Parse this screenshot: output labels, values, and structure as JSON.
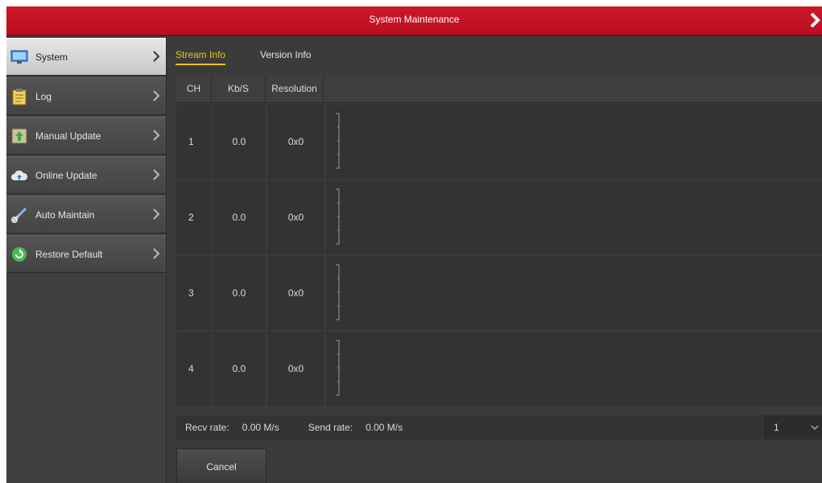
{
  "window": {
    "title": "System Maintenance"
  },
  "sidebar": {
    "items": [
      {
        "label": "System",
        "icon": "system-icon",
        "active": true
      },
      {
        "label": "Log",
        "icon": "log-icon"
      },
      {
        "label": "Manual Update",
        "icon": "manual-update-icon"
      },
      {
        "label": "Online Update",
        "icon": "cloud-icon"
      },
      {
        "label": "Auto Maintain",
        "icon": "tools-icon"
      },
      {
        "label": "Restore Default",
        "icon": "restore-icon"
      }
    ]
  },
  "tabs": [
    {
      "label": "Stream Info",
      "active": true
    },
    {
      "label": "Version Info"
    }
  ],
  "table": {
    "headers": [
      "CH",
      "Kb/S",
      "Resolution"
    ],
    "rows": [
      {
        "ch": "1",
        "kbs": "0.0",
        "resolution": "0x0"
      },
      {
        "ch": "2",
        "kbs": "0.0",
        "resolution": "0x0"
      },
      {
        "ch": "3",
        "kbs": "0.0",
        "resolution": "0x0"
      },
      {
        "ch": "4",
        "kbs": "0.0",
        "resolution": "0x0"
      }
    ]
  },
  "status": {
    "recv_label": "Recv rate:",
    "recv_value": "0.00 M/s",
    "send_label": "Send rate:",
    "send_value": "0.00 M/s",
    "page_select": "1"
  },
  "buttons": {
    "cancel": "Cancel"
  },
  "colors": {
    "title_red": "#c8142a",
    "accent_yellow": "#e8c21c"
  }
}
